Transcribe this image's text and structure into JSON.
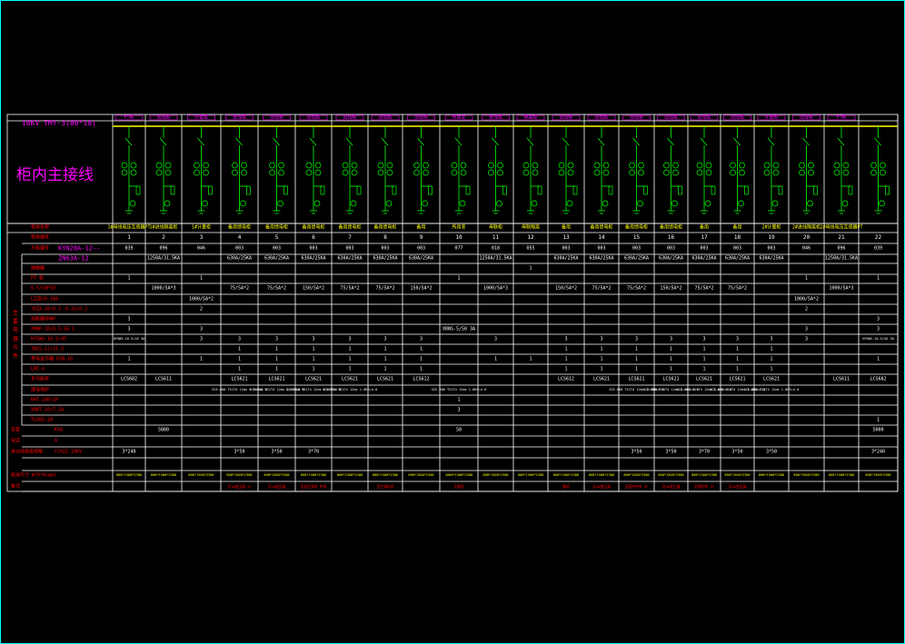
{
  "colors": {
    "frame": "#00ffff",
    "grid": "#ffffff",
    "schematic": "#00ff00",
    "title": "#ff00ff",
    "label": "#ff0000",
    "value": "#ffffff",
    "spec": "#ffff00",
    "cad_background": "#000000"
  },
  "drawing": {
    "title": "柜内主接线",
    "busbar": "10KV TMY-3(80*10)",
    "header_cells": [
      "PT柜",
      "出线柜",
      "计量柜",
      "进线柜",
      "出线柜",
      "出线柜",
      "出线柜",
      "出线柜",
      "出线柜",
      "所用变",
      "进线柜",
      "隔离柜",
      "出线柜",
      "出线柜",
      "出线柜",
      "出线柜",
      "出线柜",
      "出线柜",
      "计量柜",
      "出线柜",
      "PT柜"
    ]
  },
  "panels": {
    "names": [
      "1#母线电压互感器PT",
      "1#进线隔离柜",
      "1#计量柜",
      "备用馈电柜",
      "备用馈电柜",
      "备用馈电柜",
      "备用馈电柜",
      "备用馈电柜",
      "备用",
      "所用变",
      "母联柜",
      "母联隔离",
      "备用",
      "备用馈电柜",
      "备用馈电柜",
      "备用馈电柜",
      "备用",
      "备用",
      "2#计量柜",
      "2#进线隔离柜",
      "2#母线电压互感器PT"
    ],
    "numbers": [
      "1",
      "2",
      "3",
      "4",
      "5",
      "6",
      "7",
      "8",
      "9",
      "10",
      "11",
      "12",
      "13",
      "14",
      "15",
      "16",
      "17",
      "18",
      "19",
      "20",
      "21",
      "22"
    ],
    "schemes": [
      "039",
      "096",
      "046",
      "003",
      "003",
      "003",
      "003",
      "003",
      "003",
      "077",
      "018",
      "055",
      "003",
      "003",
      "003",
      "003",
      "003",
      "003",
      "003",
      "046",
      "096",
      "039"
    ]
  },
  "row_labels": {
    "name": "柜体名称",
    "number": "柜体编号",
    "scheme": "方案编号",
    "cabinet_model": "KYN28A-12--",
    "breaker_label": "ZN63A-12",
    "contactor": "接触器",
    "pt": "PT 柜",
    "ct_group": "电流互感器",
    "ct_1": "0.5/10P10",
    "ct_2": "LZZBJ9-10A",
    "ct_3": "0.2S/0.2",
    "ct_4": "JDZX-10/0.1",
    "ct_5": "熔断器XRNP",
    "fuse": "XRNP-10/0.5-50-1",
    "fuse_2": "XRNP1-10/0.5-50-1",
    "arrester_hy": "HY5WS-16.5/45",
    "sw_1": "JN15-12/31.5",
    "sw_2": "带电显示器 GSN-10",
    "sw_3": "LMZ-4",
    "ammeter": "多功能表",
    "relay": "继电保护",
    "relay_model": "RHT-100/2P",
    "transformer_model": "XRNT-10/7.5A",
    "earth": "TLX05-28",
    "side_title": "主要电器元件",
    "capacity": "容量",
    "capacity_unit": "KVA",
    "current_label": "电流",
    "current_unit": "A",
    "cable": "进出线电缆规格",
    "cable_model": "YJV22-10KV",
    "dimension": "柜体尺寸 W*D*H(mm)",
    "remark": "备注"
  },
  "rows": {
    "breaker": [
      "",
      "1250A/31.5KA",
      "",
      "630A/25KA",
      "630A/25KA",
      "630A/25KA",
      "630A/25KA",
      "630A/25KA",
      "630A/25KA",
      "",
      "1250A/31.5KA",
      "",
      "630A/25KA",
      "630A/25KA",
      "630A/25KA",
      "630A/25KA",
      "630A/25KA",
      "630A/25KA",
      "630A/25KA",
      "",
      "1250A/31.5KA",
      ""
    ],
    "contactor": [
      "",
      "",
      "",
      "",
      "",
      "",
      "",
      "",
      "",
      "",
      "",
      "1",
      "",
      "",
      "",
      "",
      "",
      "",
      "",
      "",
      "",
      ""
    ],
    "pt": [
      "1",
      "",
      "1",
      "",
      "",
      "",
      "",
      "",
      "",
      "1",
      "",
      "",
      "",
      "",
      "",
      "",
      "",
      "",
      "",
      "1",
      "",
      "1"
    ],
    "ct_ratio": [
      "",
      "1000/5A*3",
      "",
      "75/5A*2",
      "75/5A*2",
      "150/5A*2",
      "75/5A*2",
      "75/5A*2",
      "150/5A*2",
      "",
      "1000/5A*3",
      "",
      "150/5A*2",
      "75/5A*2",
      "75/5A*2",
      "150/5A*2",
      "75/5A*2",
      "75/5A*2",
      "",
      "",
      "1000/5A*3",
      ""
    ],
    "ct_metering": [
      "",
      "",
      "1000/5A*2",
      "",
      "",
      "",
      "",
      "",
      "",
      "",
      "",
      "",
      "",
      "",
      "",
      "",
      "",
      "",
      "",
      "1000/5A*2",
      "",
      ""
    ],
    "ct_jdzx": [
      "",
      "",
      "2",
      "",
      "",
      "",
      "",
      "",
      "",
      "",
      "",
      "",
      "",
      "",
      "",
      "",
      "",
      "",
      "",
      "2",
      "",
      ""
    ],
    "ct_fuse": [
      "3",
      "",
      "",
      "",
      "",
      "",
      "",
      "",
      "",
      "",
      "",
      "",
      "",
      "",
      "",
      "",
      "",
      "",
      "",
      "",
      "",
      "3"
    ],
    "fuse": [
      "3",
      "",
      "3",
      "",
      "",
      "",
      "",
      "",
      "",
      "XRNS-5/50 3A",
      "",
      "",
      "",
      "",
      "",
      "",
      "",
      "",
      "",
      "3",
      "",
      "3"
    ],
    "arrester": [
      "HY5WS-16.5/45 3A",
      "",
      "3",
      "3",
      "3",
      "3",
      "3",
      "3",
      "3",
      "",
      "3",
      "",
      "3",
      "3",
      "3",
      "3",
      "3",
      "3",
      "3",
      "3",
      "",
      "HY5WS-16.5/45 3A"
    ],
    "sw_1": [
      "",
      "",
      "",
      "1",
      "1",
      "1",
      "1",
      "1",
      "1",
      "",
      "",
      "",
      "1",
      "1",
      "1",
      "1",
      "1",
      "1",
      "1",
      "",
      "",
      ""
    ],
    "sw_2": [
      "1",
      "",
      "1",
      "1",
      "1",
      "1",
      "1",
      "1",
      "1",
      "",
      "1",
      "1",
      "1",
      "1",
      "1",
      "1",
      "1",
      "1",
      "1",
      "",
      "",
      "1"
    ],
    "sw_3": [
      "",
      "",
      "",
      "1",
      "1",
      "1",
      "1",
      "1",
      "1",
      "",
      "",
      "",
      "1",
      "1",
      "1",
      "1",
      "1",
      "1",
      "1",
      "",
      "",
      ""
    ],
    "ammeter": [
      "LCS682",
      "LCS611",
      "",
      "LCS621",
      "LCS621",
      "LCS621",
      "LCS621",
      "LCS621",
      "LCS612",
      "",
      "",
      "",
      "LCS612",
      "LCS621",
      "LCS621",
      "LCS621",
      "LCS621",
      "LCS621",
      "LCS621",
      "",
      "LCS611",
      "LCS682"
    ],
    "relay": [
      "",
      "",
      "",
      "SCE-600 TS1T4 12ms 1.0RS=4.0",
      "SCE-600 TS1T4 12ms 1.0RS=4.0",
      "SCE-600 TS1T4 12ms 1.0RS=4.0",
      "SCE-600 TS1T4 12ms 1.0RS=4.0",
      "",
      "",
      "SCE-600 TS1T4 12ms 1.0RS=4.0",
      "",
      "",
      "",
      "",
      "SCE-600 TS1T4 12ms 1.0RS=4.0",
      "SCE-600 TS1T4 12ms 1.0RS=4.0",
      "SCE-600 TS1T4 12ms 1.0RS=4.0",
      "SCE-600 TS1T4 12ms 1.0RS=4.0",
      "SCE-600 TS1T4 12ms 1.0RS=4.0",
      "",
      "",
      ""
    ],
    "relay_2": [
      "",
      "",
      "",
      "",
      "",
      "",
      "",
      "",
      "",
      "1",
      "",
      "",
      "",
      "",
      "",
      "",
      "",
      "",
      "",
      "",
      "",
      ""
    ],
    "transformer": [
      "",
      "",
      "",
      "",
      "",
      "",
      "",
      "",
      "",
      "3",
      "",
      "",
      "",
      "",
      "",
      "",
      "",
      "",
      "",
      "",
      "",
      ""
    ],
    "earth": [
      "",
      "",
      "",
      "",
      "",
      "",
      "",
      "",
      "",
      "",
      "",
      "",
      "",
      "",
      "",
      "",
      "",
      "",
      "",
      "",
      "",
      "1"
    ],
    "capacity": [
      "",
      "5000",
      "",
      "",
      "",
      "",
      "",
      "",
      "",
      "50",
      "",
      "",
      "",
      "",
      "",
      "",
      "",
      "",
      "",
      "",
      "",
      "5000"
    ],
    "cable": [
      "3*240",
      "",
      "",
      "3*50",
      "3*50",
      "3*70",
      "",
      "",
      "",
      "",
      "",
      "",
      "",
      "",
      "3*50",
      "3*50",
      "3*70",
      "3*50",
      "3*50",
      "",
      "",
      "3*240"
    ],
    "dimension": [
      "800*1500*2300",
      "800*1500*2300",
      "800*1500*2300",
      "800*1500*2300",
      "800*1500*2300",
      "800*1500*2300",
      "800*1500*2300",
      "800*1500*2300",
      "800*1500*2300",
      "1000*1500*2300",
      "800*1500*2300",
      "800*1500*2300",
      "800*1500*2300",
      "800*1500*2300",
      "800*1500*2300",
      "800*1500*2300",
      "800*1500*2300",
      "800*1500*2300",
      "800*1500*2300",
      "800*1500*2300",
      "800*1500*2300",
      "800*1500*2300"
    ],
    "remark": [
      "",
      "",
      "",
      "至1#变压器 2F",
      "至2#变压器",
      "至加压泵房 供电",
      "",
      "至空调机房",
      "",
      "至备用",
      "",
      "",
      "备用",
      "至5#变压器",
      "至厨房供电 2F",
      "至6#变压器",
      "至锅炉房 2F",
      "至3#变压器",
      "",
      "",
      "",
      ""
    ]
  }
}
